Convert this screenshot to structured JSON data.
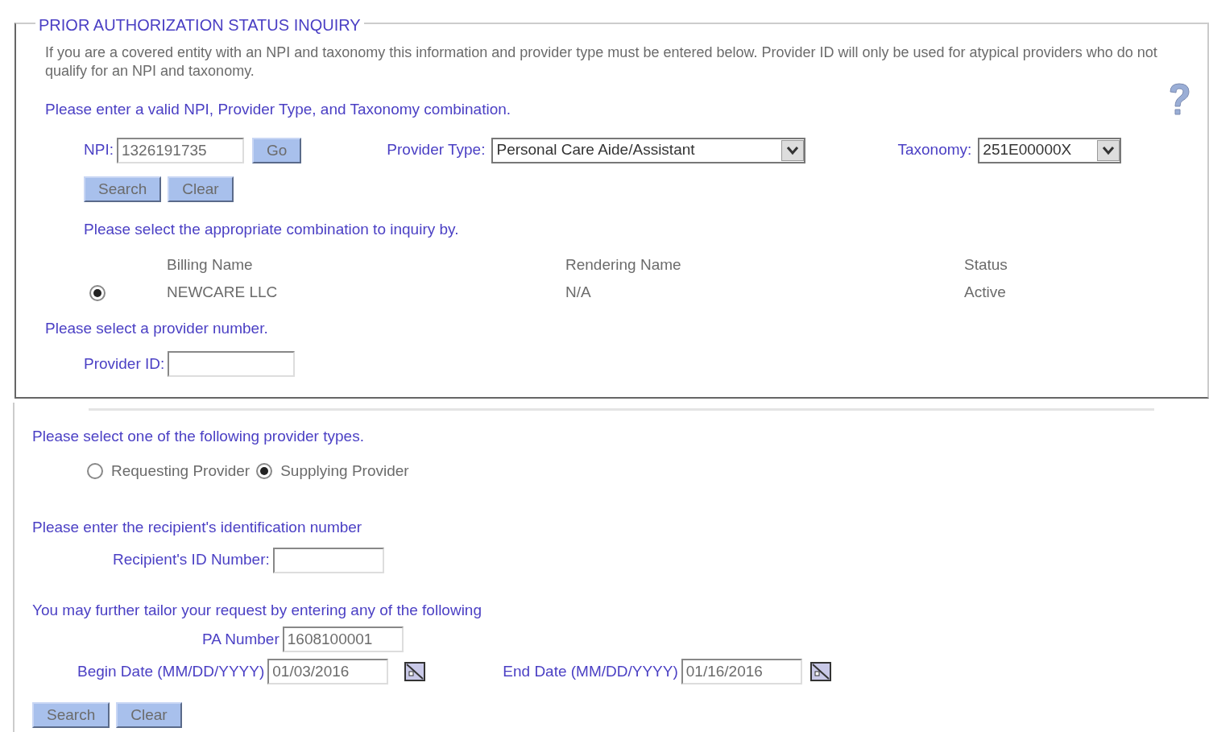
{
  "panel": {
    "legend": "PRIOR AUTHORIZATION STATUS INQUIRY",
    "intro": "If you are a covered entity with an NPI and taxonomy this information and provider type must be entered below. Provider ID will only be used for atypical providers who do not qualify for an NPI and taxonomy.",
    "npi_prompt": "Please enter a valid NPI, Provider Type, and Taxonomy combination.",
    "npi": {
      "label": "NPI:",
      "value": "1326191735"
    },
    "go_button": "Go",
    "provider_type": {
      "label": "Provider Type:",
      "value": "Personal Care Aide/Assistant"
    },
    "taxonomy": {
      "label": "Taxonomy:",
      "value": "251E00000X"
    },
    "buttons": [
      "Search",
      "Clear"
    ],
    "combination_prompt": "Please select the appropriate combination to inquiry by.",
    "combination_table": {
      "columns": [
        "Billing Name",
        "Rendering Name",
        "Status"
      ],
      "rows": [
        {
          "selected": true,
          "cells": [
            "NEWCARE LLC",
            "N/A",
            "Active"
          ]
        }
      ]
    },
    "provider_number_prompt": "Please select a provider number.",
    "provider_id": {
      "label": "Provider ID:"
    }
  },
  "provider_types": {
    "prompt": "Please select one of the following provider types.",
    "options": [
      {
        "label": "Requesting Provider",
        "selected": false
      },
      {
        "label": "Supplying Provider",
        "selected": true
      }
    ]
  },
  "recipient": {
    "prompt": "Please enter the recipient's identification number",
    "label": "Recipient's ID Number:"
  },
  "tailor": {
    "prompt": "You may further tailor your request by entering any of the following",
    "pa_number": {
      "label": "PA Number",
      "value": "1608100001"
    },
    "begin_date": {
      "label": "Begin Date (MM/DD/YYYY)",
      "value": "01/03/2016"
    },
    "end_date": {
      "label": "End Date (MM/DD/YYYY)",
      "value": "01/16/2016"
    }
  },
  "buttons": [
    "Search",
    "Clear"
  ]
}
